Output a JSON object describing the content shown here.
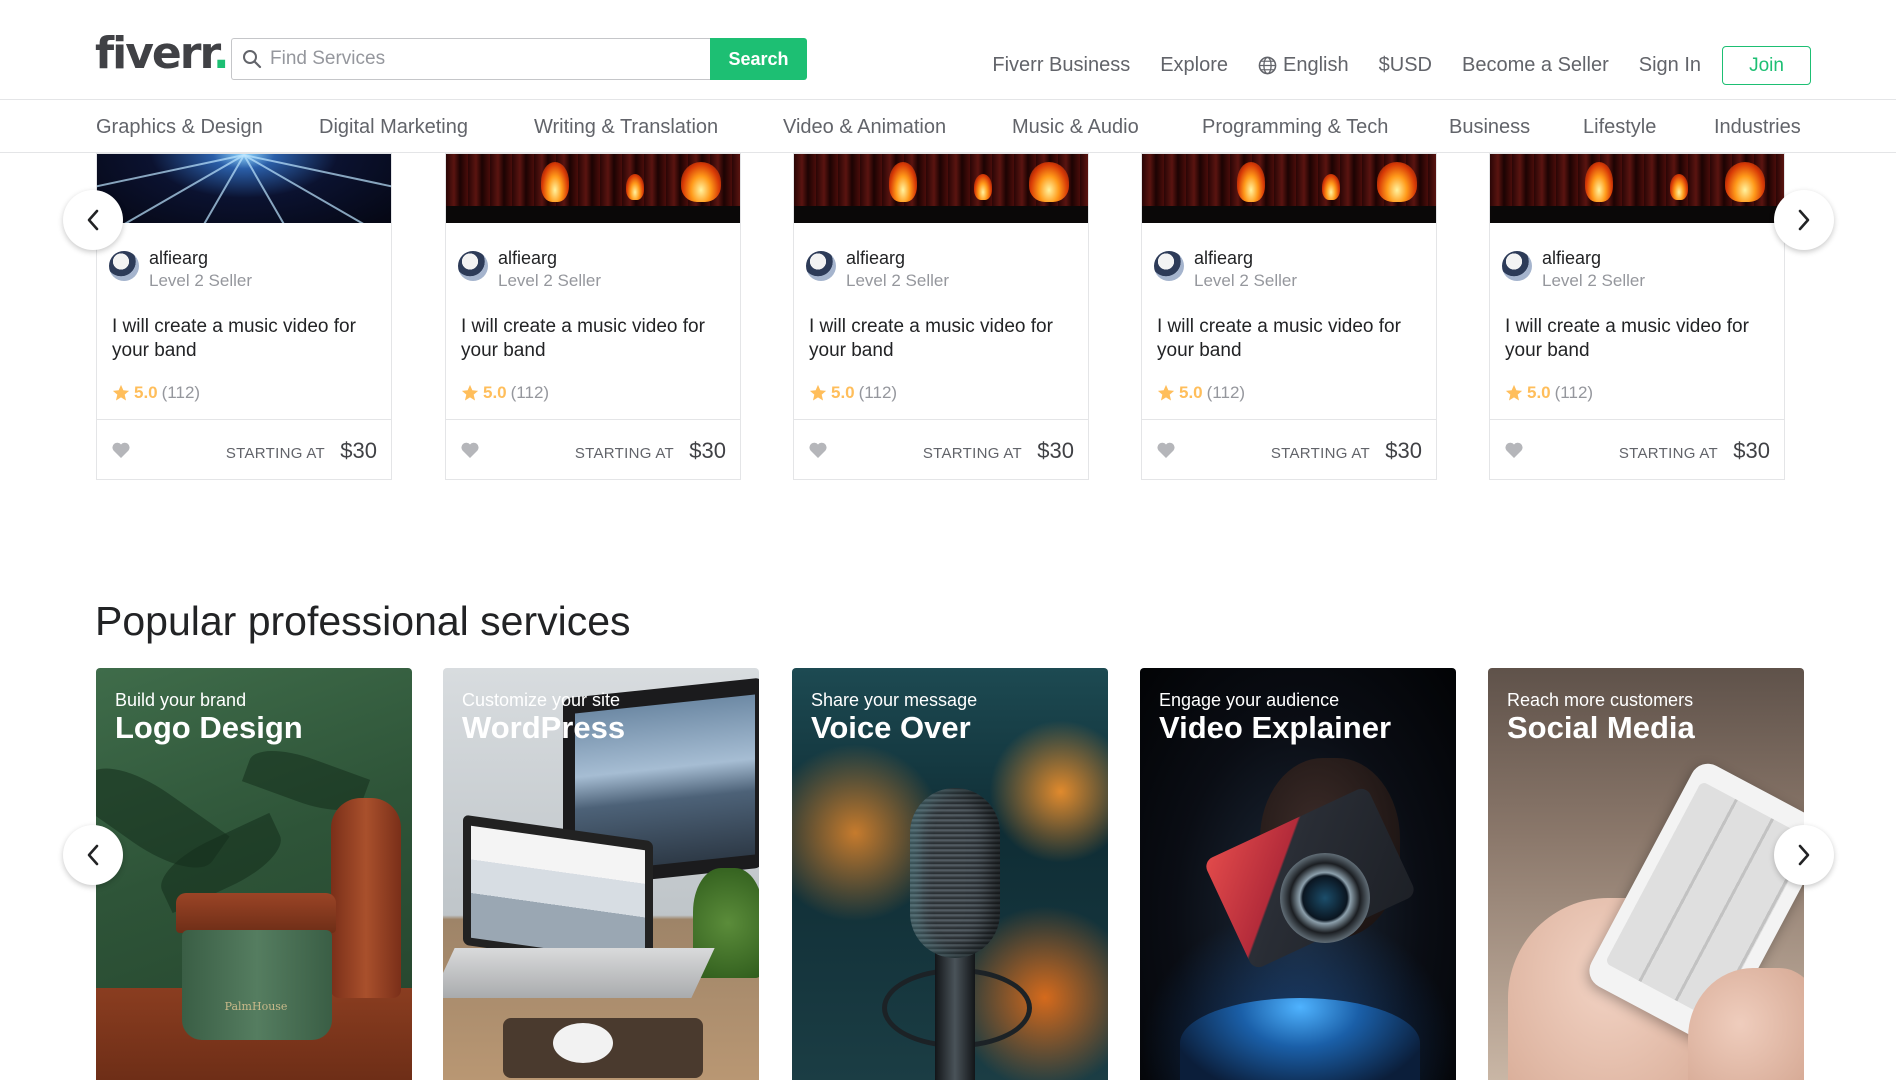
{
  "header": {
    "logo_text": "fiverr",
    "logo_dot": ".",
    "search": {
      "placeholder": "Find Services",
      "button_label": "Search"
    },
    "nav": {
      "business": "Fiverr Business",
      "explore": "Explore",
      "language": "English",
      "currency": "$USD",
      "become_seller": "Become a Seller",
      "sign_in": "Sign In",
      "join": "Join"
    },
    "icons": {
      "search": "search-icon",
      "language": "globe-icon"
    }
  },
  "categories": [
    "Graphics & Design",
    "Digital Marketing",
    "Writing & Translation",
    "Video & Animation",
    "Music & Audio",
    "Programming & Tech",
    "Business",
    "Lifestyle",
    "Industries"
  ],
  "gigs": [
    {
      "seller": "alfiearg",
      "level": "Level 2 Seller",
      "title": "I will create a music video for your band",
      "rating": "5.0",
      "reviews": "(112)",
      "starting_label": "STARTING AT",
      "price": "$30"
    },
    {
      "seller": "alfiearg",
      "level": "Level 2 Seller",
      "title": "I will create a music video for your band",
      "rating": "5.0",
      "reviews": "(112)",
      "starting_label": "STARTING AT",
      "price": "$30"
    },
    {
      "seller": "alfiearg",
      "level": "Level 2 Seller",
      "title": "I will create a music video for your band",
      "rating": "5.0",
      "reviews": "(112)",
      "starting_label": "STARTING AT",
      "price": "$30"
    },
    {
      "seller": "alfiearg",
      "level": "Level 2 Seller",
      "title": "I will create a music video for your band",
      "rating": "5.0",
      "reviews": "(112)",
      "starting_label": "STARTING AT",
      "price": "$30"
    },
    {
      "seller": "alfiearg",
      "level": "Level 2 Seller",
      "title": "I will create a music video for your band",
      "rating": "5.0",
      "reviews": "(112)",
      "starting_label": "STARTING AT",
      "price": "$30"
    }
  ],
  "popular": {
    "title": "Popular professional services",
    "services": [
      {
        "sub": "Build your brand",
        "name": "Logo Design",
        "image_label": "PalmHouse"
      },
      {
        "sub": "Customize your site",
        "name": "WordPress"
      },
      {
        "sub": "Share your message",
        "name": "Voice Over"
      },
      {
        "sub": "Engage your audience",
        "name": "Video Explainer"
      },
      {
        "sub": "Reach more customers",
        "name": "Social Media"
      }
    ]
  },
  "colors": {
    "brand_green": "#1dbf73",
    "star_yellow": "#ffbe5b",
    "text_dark": "#222325",
    "text_muted": "#95979d"
  }
}
